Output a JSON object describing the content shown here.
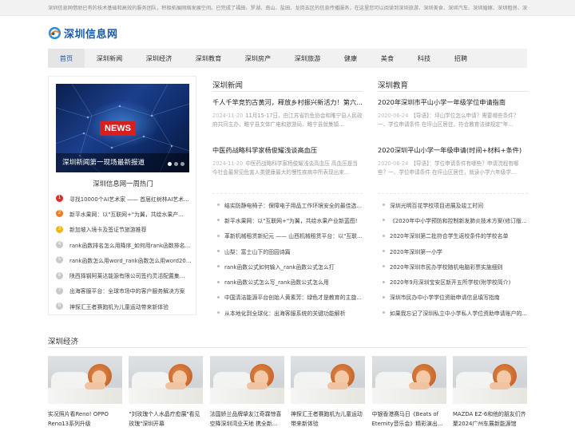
{
  "topbar": {
    "text": "深圳信息网借助已有的技术基础和高效的服务团队，积极拓展网络发展空间。已完成了福田、罗湖、南山、盐田、龙岗五区的信息传播服务，在这里您可以阅读到深圳旅游、深圳美食、深圳汽车、深圳婚嫁、深圳租房、深圳招..."
  },
  "logo": {
    "text": "深圳信息网"
  },
  "nav": {
    "items": [
      "首页",
      "深圳新闻",
      "深圳经济",
      "深圳教育",
      "深圳房产",
      "深圳旅游",
      "健康",
      "美食",
      "科技",
      "招聘"
    ],
    "active": 0
  },
  "hero": {
    "badge": "NEWS",
    "caption": "深圳新闻第一现场最新报道"
  },
  "hot": {
    "title": "深圳信息网一周热门",
    "items": [
      "寻找10000个AI艺术家 —— 首届红树林AI艺术...",
      "新平水果网：以\"互联网+\"为翼，共绘水果产...",
      "新加坡入境卡及签证节旅游推荐",
      "rank函数排名怎么用降序_如何用rank函数排名...",
      "rank函数怎么用word_rank函数怎么用word2010",
      "陕西择钢阿莱达能源有限公司签约灵活配置集...",
      "出海客服平台：全球市场中的客户服务解决方案",
      "神探汇王者赛跑机为儿童运动带来新体验"
    ]
  },
  "news": {
    "heading": "深圳新闻",
    "featured": [
      {
        "title": "千人千竿竞钓古黄河，释放乡村振兴新活力！第六...",
        "date": "2024-11-20",
        "desc": "11月15-17日，由江苏省钓鱼协会和睢宁县人民政府共同主办，睢宁县文体广电和旅游局、睢宁县就集镇..."
      },
      {
        "title": "中医药战略科学家杨俊耀浅谈高血压",
        "date": "2024-11-20",
        "desc": "中医药战略科学家杨俊耀浅谈高血压 高血压是当今社会最常见危害人类健康最大的慢性疾病中所表现出来..."
      }
    ],
    "list": [
      "结实防静电椅子：保障电子用品工作环境安全的最佳选...",
      "新平水果网：以\"互联网+\"为翼，共绘水果产业新蓝图!",
      "革新机械租赁新纪元 —— 山西机械租赁平台：以\"互联网+\"...",
      "山梨：富士山下的田园诗篇",
      "rank函数公式如何输入_rank函数公式怎么打",
      "rank函数公式怎么写_rank函数公式怎么用",
      "中国清洁能源平台创始人黄素芳：绿色才是教育的主旋...",
      "从本地化到全球化：出海客服系统的关键功能解析"
    ]
  },
  "edu": {
    "heading": "深圳教育",
    "featured": [
      {
        "title": "2020年深圳市平山小学一年级学位申请指南",
        "date": "2020-06-24",
        "desc": "【导语】：坪山学位怎么申请？需要哪些条件？一、学位申请条件 在坪山区居住，符合教育法律规定\"年..."
      },
      {
        "title": "2020深圳平山小学一年级申请(时间+材料+条件)",
        "date": "2020-06-24",
        "desc": "【导语】：学位申请条件有哪些？申请流程有哪些？一、学位申请条件 在坪山区居住，就读小学六年级学..."
      }
    ],
    "list": [
      "深圳光明百花学校项目进展及竣工时间",
      "《2020年中小学预防和控制新发肺炎技术方案(修订版)》",
      "2020年深圳第二批符合学生返校条件的学校名单",
      "2020年深圳第一小学",
      "2020年深圳市民办学校随机电脑彩票实施细则",
      "2020年9月深圳宝安区新开五所学校(附学校简介)",
      "深圳市民办中小学学位资助申请信息填写指南",
      "如果我忘记了深圳私立中小学私人学位资助申请账户的..."
    ]
  },
  "economy": {
    "heading": "深圳经济",
    "cards": [
      "实况照片看Reno! OPPO Reno13系列升级LivePhoto...",
      "\"刘玫瑰个人水晶疗愈展\"看见玫瑰\"深圳开幕",
      "法国娇兰品牌挚友江奇霖惊喜空降深圳湾业天地 携全新...",
      "神探汇王者赛跑机为儿童运动带来新体验",
      "中银香港赛马日《Beats of Eternity音乐会》精彩演出...",
      "MAZDA EZ-6和他的朋友们齐聚2024广州车展新能源馆"
    ]
  },
  "colors": {
    "brand": "#1a5aa8",
    "hot_rank_1": "#e5282b",
    "hot_rank_2": "#ef7c1a",
    "hot_rank_3": "#f2b21a",
    "news_badge": "#d81e1e"
  }
}
